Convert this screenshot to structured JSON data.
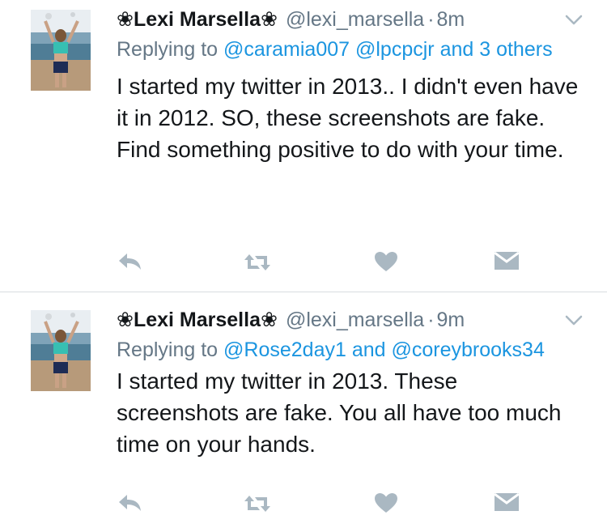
{
  "colors": {
    "link": "#1b95e0",
    "meta": "#657786",
    "icon": "#aab8c2",
    "text": "#14171a",
    "divider": "#d8dde1"
  },
  "icons": {
    "reply": "reply-icon",
    "retweet": "retweet-icon",
    "like": "heart-icon",
    "dm": "direct-message-icon",
    "more": "chevron-down-icon"
  },
  "tweets": [
    {
      "name": "❀Lexi Marsella❀",
      "handle": "@lexi_marsella",
      "dot": "·",
      "time": "8m",
      "replying_prefix": "Replying to ",
      "mention1": "@caramia007",
      "mention2": "@lpcpcjr",
      "replying_suffix": "and 3 others",
      "text": "I started my twitter in 2013.. I didn't even have it in 2012. SO, these screenshots are fake. Find something positive to do with your time."
    },
    {
      "name": "❀Lexi Marsella❀",
      "handle": "@lexi_marsella",
      "dot": "·",
      "time": "9m",
      "replying_prefix": "Replying to ",
      "mention1": "@Rose2day1",
      "joiner": " and ",
      "mention2": "@coreybrooks34",
      "text": "I started my twitter in 2013. These screenshots are fake. You all have too much time on your hands."
    }
  ]
}
